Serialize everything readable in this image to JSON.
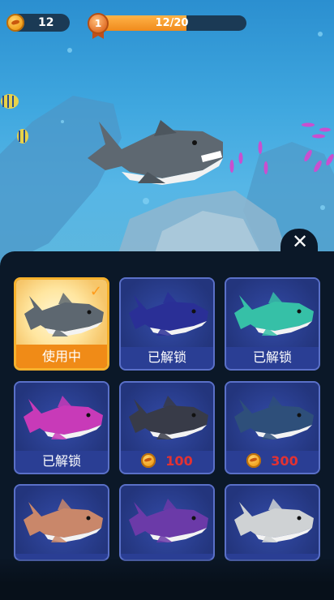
{
  "hud": {
    "coins": "12",
    "level": "1",
    "progress_text": "12/20",
    "progress_fraction": 0.6
  },
  "icons": {
    "coin": "coin-icon",
    "close": "close-icon",
    "check": "checkmark-icon",
    "level_badge": "medal-icon"
  },
  "shop": {
    "close_label": "✕",
    "items": [
      {
        "name": "great-white-shark",
        "label": "使用中",
        "state": "selected",
        "body": "#5d6770"
      },
      {
        "name": "blue-shark",
        "label": "已解锁",
        "state": "unlocked",
        "body": "#2a2f96"
      },
      {
        "name": "teal-shark",
        "label": "已解锁",
        "state": "unlocked",
        "body": "#36c0a7"
      },
      {
        "name": "pink-shark",
        "label": "已解锁",
        "state": "unlocked",
        "body": "#c83ab8"
      },
      {
        "name": "rocket-shark",
        "label": "100",
        "state": "locked",
        "body": "#383b48"
      },
      {
        "name": "hammerhead-shark",
        "label": "300",
        "state": "locked",
        "body": "#2e4f7a"
      },
      {
        "name": "pig-shark",
        "label": "",
        "state": "partial",
        "body": "#c9876a"
      },
      {
        "name": "sawfish-shark",
        "label": "",
        "state": "partial",
        "body": "#6b3aa8"
      },
      {
        "name": "skeleton-shark",
        "label": "",
        "state": "partial",
        "body": "#cfd2d4"
      }
    ]
  },
  "colors": {
    "accent_orange": "#f08b17",
    "price_red": "#e33232",
    "card_blue": "#2a3e94"
  }
}
